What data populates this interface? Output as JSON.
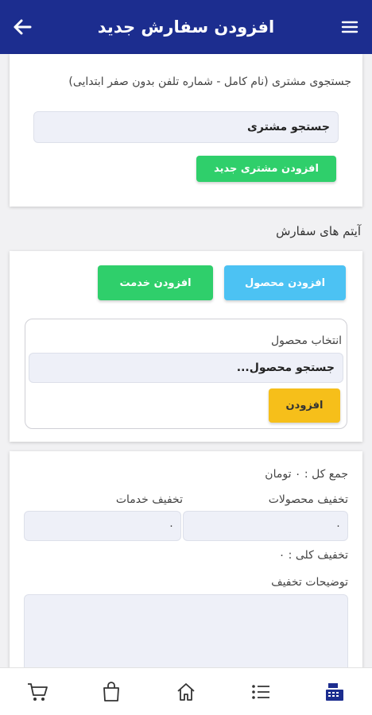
{
  "header": {
    "title": "افزودن سفارش جدید"
  },
  "customer": {
    "label": "جستجوی مشتری (نام کامل - شماره تلفن بدون صفر ابتدایی)",
    "search_placeholder": "جستجو مشتری",
    "add_button": "افزودن مشتری جدید"
  },
  "order_items": {
    "title": "آیتم های سفارش",
    "add_product_button": "افزودن محصول",
    "add_service_button": "افزودن خدمت",
    "product_label": "انتخاب محصول",
    "product_search": "جستجو محصول...",
    "add_button": "افزودن"
  },
  "summary": {
    "total_text": "جمع کل : ۰ تومان",
    "product_discount_label": "تخفیف محصولات",
    "product_discount_value": "۰",
    "service_discount_label": "تخفیف خدمات",
    "service_discount_value": "۰",
    "total_discount_text": "تخفیف کلی : ۰",
    "discount_notes_label": "توضیحات تخفیف"
  },
  "colors": {
    "header": "#1c2d8f",
    "green": "#2fcf6b",
    "blue": "#4cc2f3",
    "yellow": "#f6bf1a"
  },
  "nav": [
    "cart-icon",
    "bag-icon",
    "home-icon",
    "list-icon",
    "register-icon"
  ]
}
